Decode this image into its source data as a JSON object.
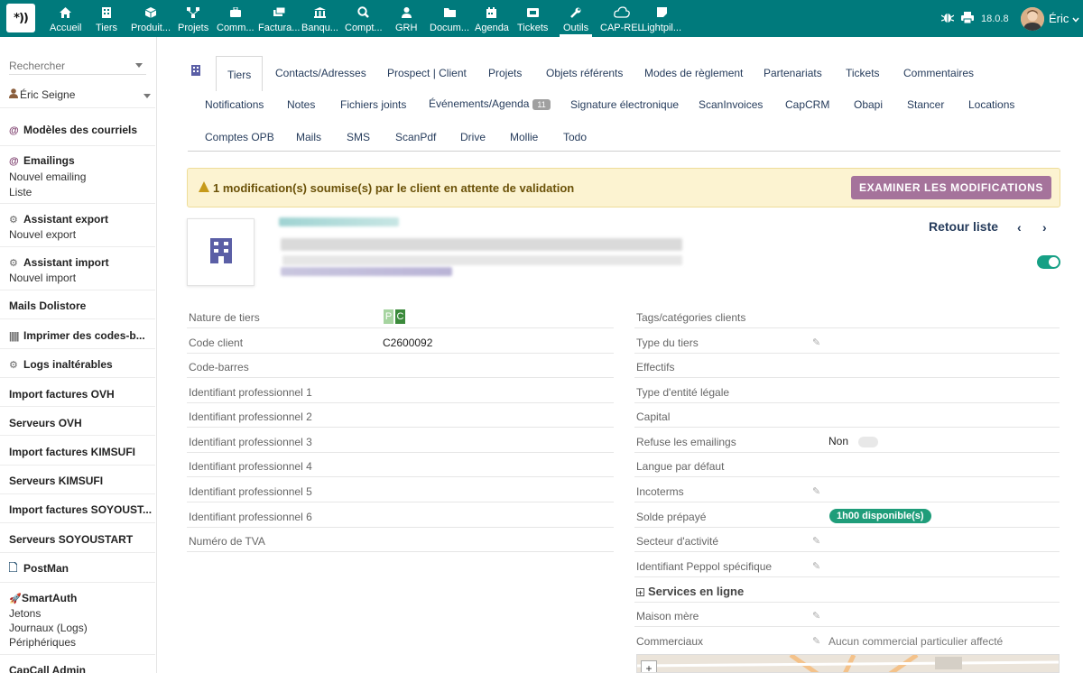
{
  "topbar": {
    "logo_text": "*))",
    "menu": [
      {
        "label": "Accueil",
        "icon": "home-icon"
      },
      {
        "label": "Tiers",
        "icon": "building-icon"
      },
      {
        "label": "Produit...",
        "icon": "cube-icon"
      },
      {
        "label": "Projets",
        "icon": "sitemap-icon"
      },
      {
        "label": "Comm...",
        "icon": "suitcase-icon"
      },
      {
        "label": "Factura...",
        "icon": "money-icon"
      },
      {
        "label": "Banqu...",
        "icon": "bank-icon"
      },
      {
        "label": "Compt...",
        "icon": "search-dollar-icon"
      },
      {
        "label": "GRH",
        "icon": "user-tie-icon"
      },
      {
        "label": "Docum...",
        "icon": "folder-icon"
      },
      {
        "label": "Agenda",
        "icon": "calendar-icon"
      },
      {
        "label": "Tickets",
        "icon": "ticket-icon"
      },
      {
        "label": "Outils",
        "icon": "wrench-icon"
      },
      {
        "label": "CAP-REL",
        "icon": "cloud-icon"
      },
      {
        "label": "Lightpil...",
        "icon": "sticky-note-icon"
      }
    ],
    "version": "18.0.8",
    "user_name": "Éric"
  },
  "sidebar": {
    "search_placeholder": "Rechercher",
    "user_select": "Éric Seigne",
    "blocks": [
      {
        "title": "Modèles des courriels",
        "icon": "at-icon",
        "subs": []
      },
      {
        "title": "Emailings",
        "icon": "at-icon",
        "subs": [
          "Nouvel emailing",
          "Liste"
        ]
      },
      {
        "title": "Assistant export",
        "icon": "cogs-icon",
        "subs": [
          "Nouvel export"
        ]
      },
      {
        "title": "Assistant import",
        "icon": "cogs-icon",
        "subs": [
          "Nouvel import"
        ]
      },
      {
        "title": "Mails Dolistore",
        "icon": "",
        "subs": []
      },
      {
        "title": "Imprimer des codes-b...",
        "icon": "barcode-icon",
        "subs": []
      },
      {
        "title": "Logs inaltérables",
        "icon": "cogs-icon",
        "subs": []
      },
      {
        "title": "Import factures OVH",
        "icon": "",
        "subs": []
      },
      {
        "title": "Serveurs OVH",
        "icon": "",
        "subs": []
      },
      {
        "title": "Import factures KIMSUFI",
        "icon": "",
        "subs": []
      },
      {
        "title": "Serveurs KIMSUFI",
        "icon": "",
        "subs": []
      },
      {
        "title": "Import factures SOYOUST...",
        "icon": "",
        "subs": []
      },
      {
        "title": "Serveurs SOYOUSTART",
        "icon": "",
        "subs": []
      },
      {
        "title": "PostMan",
        "icon": "file-icon",
        "subs": []
      },
      {
        "title": "SmartAuth",
        "icon": "rocket-icon",
        "subs": [
          "Jetons",
          "Journaux (Logs)",
          "Périphériques"
        ]
      },
      {
        "title": "CapCall Admin",
        "icon": "",
        "subs": []
      }
    ]
  },
  "tabs": {
    "row1": [
      "Tiers",
      "Contacts/Adresses",
      "Prospect | Client",
      "Projets",
      "Objets référents",
      "Modes de règlement",
      "Partenariats",
      "Tickets",
      "Commentaires"
    ],
    "row2": [
      "Notifications",
      "Notes",
      "Fichiers joints",
      "Événements/Agenda",
      "Signature électronique",
      "ScanInvoices",
      "CapCRM",
      "Obapi",
      "Stancer",
      "Locations"
    ],
    "row2_badge": "11",
    "row3": [
      "Comptes OPB",
      "Mails",
      "SMS",
      "ScanPdf",
      "Drive",
      "Mollie",
      "Todo"
    ]
  },
  "warning": {
    "text": "1 modification(s) soumise(s) par le client en attente de validation",
    "button": "EXAMINER LES MODIFICATIONS"
  },
  "header": {
    "back_link": "Retour liste",
    "prev": "‹",
    "next": "›"
  },
  "left_fields": [
    {
      "label": "Nature de tiers",
      "value": ""
    },
    {
      "label": "Code client",
      "value": "C2600092"
    },
    {
      "label": "Code-barres",
      "value": ""
    },
    {
      "label": "Identifiant professionnel 1",
      "value": ""
    },
    {
      "label": "Identifiant professionnel 2",
      "value": ""
    },
    {
      "label": "Identifiant professionnel 3",
      "value": ""
    },
    {
      "label": "Identifiant professionnel 4",
      "value": ""
    },
    {
      "label": "Identifiant professionnel 5",
      "value": ""
    },
    {
      "label": "Identifiant professionnel 6",
      "value": ""
    },
    {
      "label": "Numéro de TVA",
      "value": ""
    }
  ],
  "nature_badges": [
    "P",
    "C"
  ],
  "right_fields": [
    {
      "label": "Tags/catégories clients",
      "value": "",
      "editable": false
    },
    {
      "label": "Type du tiers",
      "value": "",
      "editable": true
    },
    {
      "label": "Effectifs",
      "value": "",
      "editable": false
    },
    {
      "label": "Type d'entité légale",
      "value": "",
      "editable": false
    },
    {
      "label": "Capital",
      "value": "",
      "editable": false
    },
    {
      "label": "Refuse les emailings",
      "value": "Non",
      "editable": false
    },
    {
      "label": "Langue par défaut",
      "value": "",
      "editable": false
    },
    {
      "label": "Incoterms",
      "value": "",
      "editable": true
    },
    {
      "label": "Solde prépayé",
      "value": "1h00 disponible(s)",
      "editable": false
    },
    {
      "label": "Secteur d'activité",
      "value": "",
      "editable": true
    },
    {
      "label": "Identifiant Peppol spécifique",
      "value": "",
      "editable": true
    },
    {
      "label": "Services en ligne",
      "value": "",
      "editable": false
    },
    {
      "label": "Maison mère",
      "value": "",
      "editable": true
    },
    {
      "label": "Commerciaux",
      "value": "Aucun commercial particulier affecté",
      "editable": true
    }
  ],
  "colors": {
    "topbar": "#007a7c",
    "accent_button": "#a5739b",
    "toggle_on": "#16a085",
    "badge_green": "#1f9d7a"
  }
}
